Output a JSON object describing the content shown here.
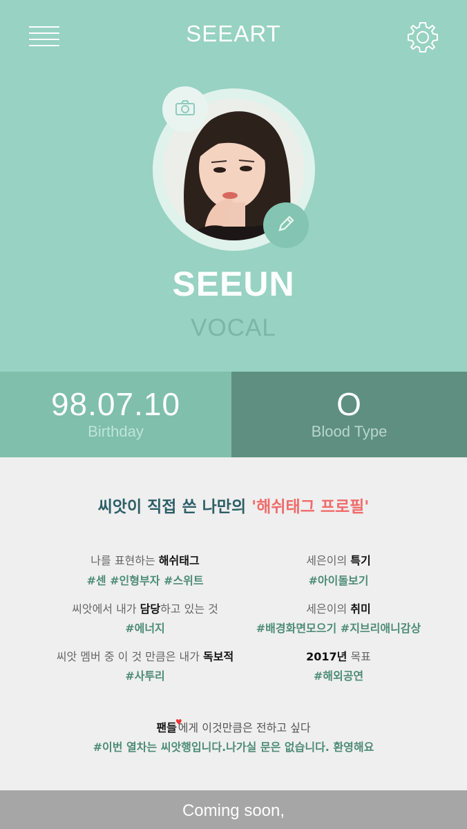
{
  "header": {
    "title": "SEEART",
    "menu_icon": "hamburger-menu-icon",
    "settings_icon": "gear-icon"
  },
  "profile": {
    "name": "SEEUN",
    "role": "VOCAL",
    "camera_icon": "camera-icon",
    "edit_icon": "pencil-icon"
  },
  "stats": {
    "birthday": {
      "value": "98.07.10",
      "label": "Birthday"
    },
    "blood": {
      "value": "O",
      "label": "Blood Type"
    }
  },
  "hashtag_profile": {
    "title_dark": "씨앗이 직접 쓴 나만의 ",
    "title_pink": "'해쉬태그 프로필'",
    "items": [
      {
        "q_pre": "나를 표현하는 ",
        "q_bold": "해쉬태그",
        "q_post": "",
        "tags": "#센 #인형부자 #스위트"
      },
      {
        "q_pre": "세은이의 ",
        "q_bold": "특기",
        "q_post": "",
        "tags": "#아이돌보기"
      },
      {
        "q_pre": "씨앗에서 내가 ",
        "q_bold": "담당",
        "q_post": "하고 있는 것",
        "tags": "#에너지"
      },
      {
        "q_pre": "세은이의 ",
        "q_bold": "취미",
        "q_post": "",
        "tags": "#배경화면모으기 #지브리애니감상"
      },
      {
        "q_pre": "씨앗 멤버 중 이 것 만큼은 내가 ",
        "q_bold": "독보적",
        "q_post": "",
        "tags": "#사투리"
      },
      {
        "q_pre": "",
        "q_bold": "2017년",
        "q_post": " 목표",
        "tags": "#해외공연"
      }
    ],
    "fans": {
      "q_bold": "팬들",
      "q_post": "에게 이것만큼은 전하고 싶다",
      "tags": "#이번 열차는 씨앗행입니다.나가실 문은 없습니다. 환영해요"
    }
  },
  "footer": {
    "text": "Coming soon,"
  },
  "colors": {
    "mint": "#97d2c2",
    "mint_mid": "#7fbfac",
    "mint_dark": "#5e8f81",
    "tag_green": "#4d8b76",
    "accent_pink": "#f06a6a"
  }
}
